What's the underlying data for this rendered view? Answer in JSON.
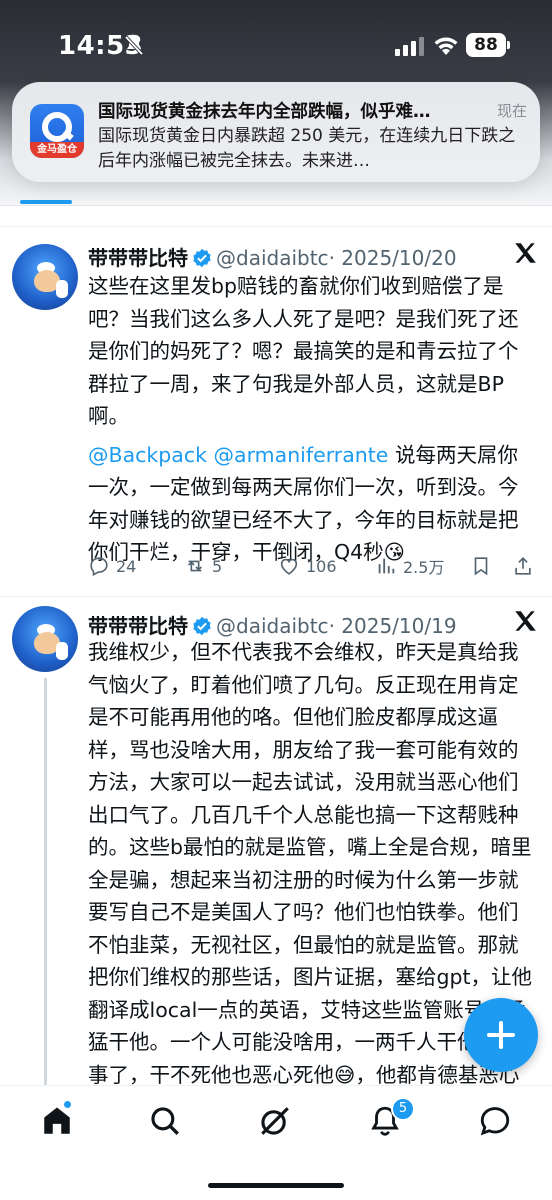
{
  "status_bar": {
    "time": "14:53",
    "battery": "88",
    "icons": [
      "bell-slash-icon",
      "signal-icon",
      "wifi-icon",
      "battery-icon"
    ]
  },
  "notification": {
    "app_icon_label": "金马盈仓",
    "title": "国际现货黄金抹去年内全部跌幅，似乎难…",
    "time": "现在",
    "body": "国际现货黄金日内暴跌超 250 美元，在连续九日下跌之后年内涨幅已被完全抹去。未来进…"
  },
  "tweets": [
    {
      "name": "带带带比特",
      "handle": "@daidaibtc",
      "date": "· 2025/10/20",
      "text_p1": "这些在这里发bp赔钱的畜就你们收到赔偿了是吧？当我们这么多人人死了是吧？是我们死了还是你们的妈死了？嗯？最搞笑的是和青云拉了个群拉了一周，来了句我是外部人员，这就是BP啊。",
      "mention1": "@Backpack",
      "mention2": "@armaniferrante",
      "text_p2": " 说每两天屌你一次，一定做到每两天屌你们一次，听到没。今年对赚钱的欲望已经不大了，今年的目标就是把你们干烂，干穿，干倒闭，Q4秒😘",
      "replies": "24",
      "retweets": "5",
      "likes": "106",
      "views": "2.5万"
    },
    {
      "name": "带带带比特",
      "handle": "@daidaibtc",
      "date": "· 2025/10/19",
      "text": "我维权少，但不代表我不会维权，昨天是真给我气恼火了，盯着他们喷了几句。反正现在用肯定是不可能再用他的咯。但他们脸皮都厚成这逼样，骂也没啥大用，朋友给了我一套可能有效的方法，大家可以一起去试试，没用就当恶心他们出口气了。几百几千个人总能也搞一下这帮贱种的。这些b最怕的就是监管，嘴上全是合规，暗里全是骗，想起来当初注册的时候为什么第一步就要写自己不是美国人了吗？他们也怕铁拳。他们不怕韭菜，无视社区，但最怕的就是监管。那就把你们维权的那些话，图片证据，塞给gpt，让他翻译成local一点的英语，艾特这些监管账号，猛猛干他。一个人可能没啥用，一两千人干他就完事了，干不死他也恶心死他😅，他都肯德基恶心人了，恶"
    }
  ],
  "bottom_nav": {
    "items": [
      "home-icon",
      "search-icon",
      "grok-icon",
      "notifications-icon",
      "messages-icon"
    ],
    "notifications_badge": "5"
  },
  "colors": {
    "accent": "#1d9bf0",
    "text": "#0f1419",
    "secondary_text": "#536471"
  }
}
